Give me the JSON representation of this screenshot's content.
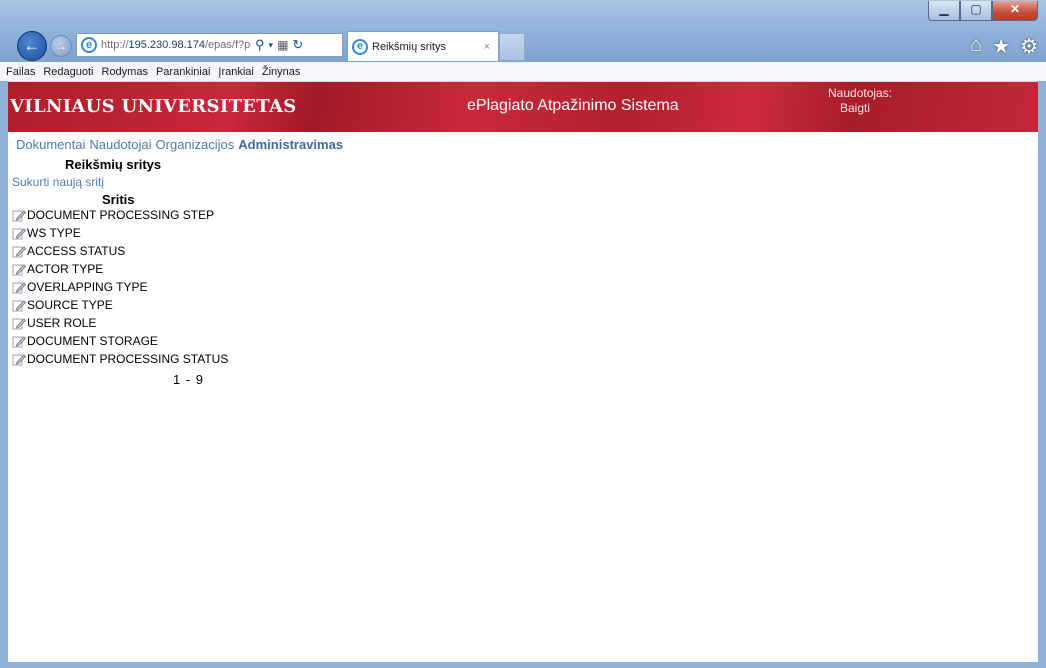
{
  "browser": {
    "url_prefix": "http://",
    "url_host": "195.230.98.174",
    "url_path": "/epas/f?p=",
    "tab_title": "Reikšmių sritys",
    "tab_close": "×"
  },
  "menu": [
    "Failas",
    "Redaguoti",
    "Rodymas",
    "Parankiniai",
    "Įrankiai",
    "Žinynas"
  ],
  "header": {
    "brand": "VILNIAUS UNIVERSITETAS",
    "system_name": "ePlagiato Atpažinimo Sistema",
    "user_label": "Naudotojas:",
    "logout": "Baigti"
  },
  "nav": [
    {
      "label": "Dokumentai",
      "active": false
    },
    {
      "label": "Naudotojai",
      "active": false
    },
    {
      "label": "Organizacijos",
      "active": false
    },
    {
      "label": "Administravimas",
      "active": true
    }
  ],
  "page_title": "Reikšmių sritys",
  "create_link": "Sukurti naują sritį",
  "table": {
    "column": "Sritis",
    "rows": [
      "DOCUMENT PROCESSING STEP",
      "WS TYPE",
      "ACCESS STATUS",
      "ACTOR TYPE",
      "OVERLAPPING TYPE",
      "SOURCE TYPE",
      "USER ROLE",
      "DOCUMENT STORAGE",
      "DOCUMENT PROCESSING STATUS"
    ]
  },
  "pagination": "1 - 9",
  "colors": {
    "banner": "#b01e2a",
    "link": "#4b7bb4"
  },
  "icons": {
    "edit": "edit-pencil-icon",
    "ie": "ie-icon",
    "home": "home-icon",
    "favorites": "star-icon",
    "tools": "gear-icon"
  }
}
